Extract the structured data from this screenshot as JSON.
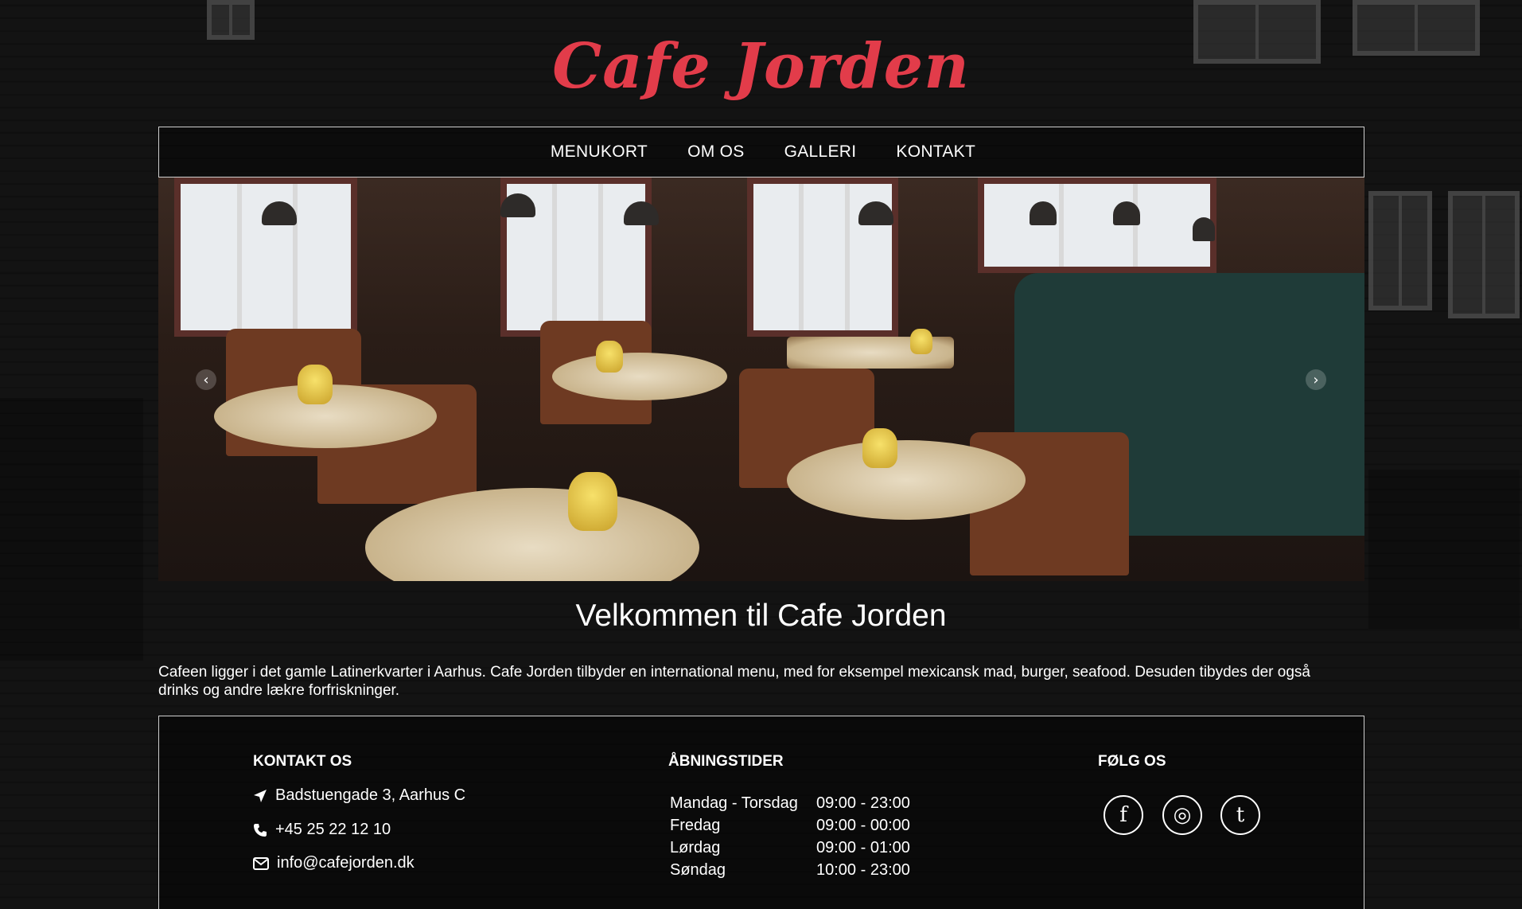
{
  "brand": {
    "logo_text": "Cafe Jorden",
    "logo_color": "#e23c4a"
  },
  "nav": {
    "items": [
      {
        "label": "MENUKORT"
      },
      {
        "label": "OM OS"
      },
      {
        "label": "GALLERI"
      },
      {
        "label": "KONTAKT"
      }
    ]
  },
  "slider": {
    "prev_icon": "chevron-left-icon",
    "next_icon": "chevron-right-icon",
    "prev_glyph": "‹",
    "next_glyph": "›"
  },
  "main": {
    "title": "Velkommen til Cafe Jorden",
    "intro": "Cafeen ligger i det gamle Latinerkvarter i Aarhus. Cafe Jorden tilbyder en international menu, med for eksempel mexicansk mad, burger, seafood. Desuden tibydes der også drinks og andre lækre forfriskninger."
  },
  "footer": {
    "contact": {
      "title": "KONTAKT OS",
      "address": "Badstuengade 3, Aarhus C",
      "phone": "+45 25 22 12 10",
      "email": "info@cafejorden.dk"
    },
    "hours": {
      "title": "ÅBNINGSTIDER",
      "rows": [
        {
          "day": "Mandag - Torsdag",
          "time": "09:00 - 23:00"
        },
        {
          "day": "Fredag",
          "time": "09:00 - 00:00"
        },
        {
          "day": "Lørdag",
          "time": "09:00 - 01:00"
        },
        {
          "day": "Søndag",
          "time": "10:00 - 23:00"
        }
      ]
    },
    "social": {
      "title": "FØLG OS",
      "items": [
        {
          "icon": "facebook-icon",
          "glyph": "f"
        },
        {
          "icon": "instagram-icon",
          "glyph": "◎"
        },
        {
          "icon": "tumblr-icon",
          "glyph": "t"
        }
      ]
    }
  }
}
